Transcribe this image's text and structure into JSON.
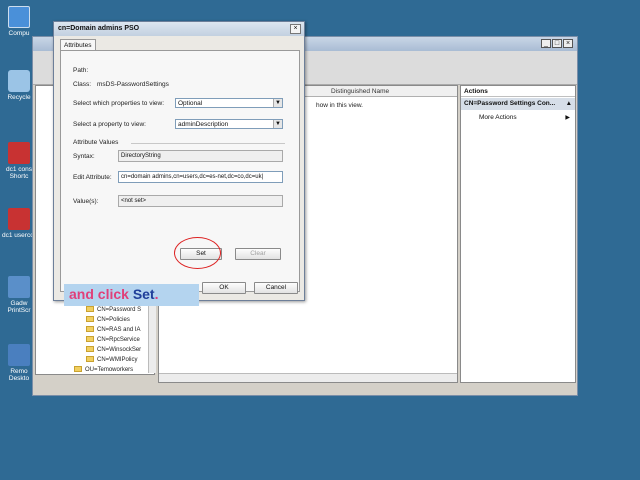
{
  "desktop": {
    "icons": [
      {
        "label": "Compu",
        "color": "#4a90d9"
      },
      {
        "label": "Recycle",
        "color": "#9bc4e6"
      },
      {
        "label": "dc1 cons Shortc",
        "color": "#c83232"
      },
      {
        "label": "dc1 usercor",
        "color": "#c83232"
      },
      {
        "label": "Gadw PrintScr",
        "color": "#5a8fc9"
      },
      {
        "label": "Remo Deskto",
        "color": "#4a7fbf"
      }
    ]
  },
  "mmc": {
    "column_header": "Distinguished Name",
    "body_text": "how in this view.",
    "actions_title": "Actions",
    "actions_selected": "CN=Password Settings Con...",
    "more_actions": "More Actions",
    "tree": [
      "CN=Password S",
      "CN=Policies",
      "CN=RAS and IA",
      "CN=RpcService",
      "CN=WinsockSer",
      "CN=WMIPolicy",
      "OU=Temoworkers"
    ]
  },
  "dialog": {
    "title": "cn=Domain admins PSO",
    "tab": "Attributes",
    "path_label": "Path:",
    "class_label": "Class:",
    "class_value": "msDS-PasswordSettings",
    "properties_label": "Select which properties to view:",
    "properties_value": "Optional",
    "property_label": "Select a property to view:",
    "property_value": "adminDescription",
    "attr_values_label": "Attribute Values",
    "syntax_label": "Syntax:",
    "syntax_value": "DirectoryString",
    "edit_label": "Edit Attribute:",
    "edit_value": "cn=domain admins,cn=users,dc=es-net,dc=co,dc=uk|",
    "values_label": "Value(s):",
    "values_value": "<not set>",
    "set_label": "Set",
    "clear_label": "Clear",
    "ok_label": "OK",
    "cancel_label": "Cancel"
  },
  "caption": {
    "prefix": "and click ",
    "emphasis": "Set",
    "suffix": "."
  }
}
